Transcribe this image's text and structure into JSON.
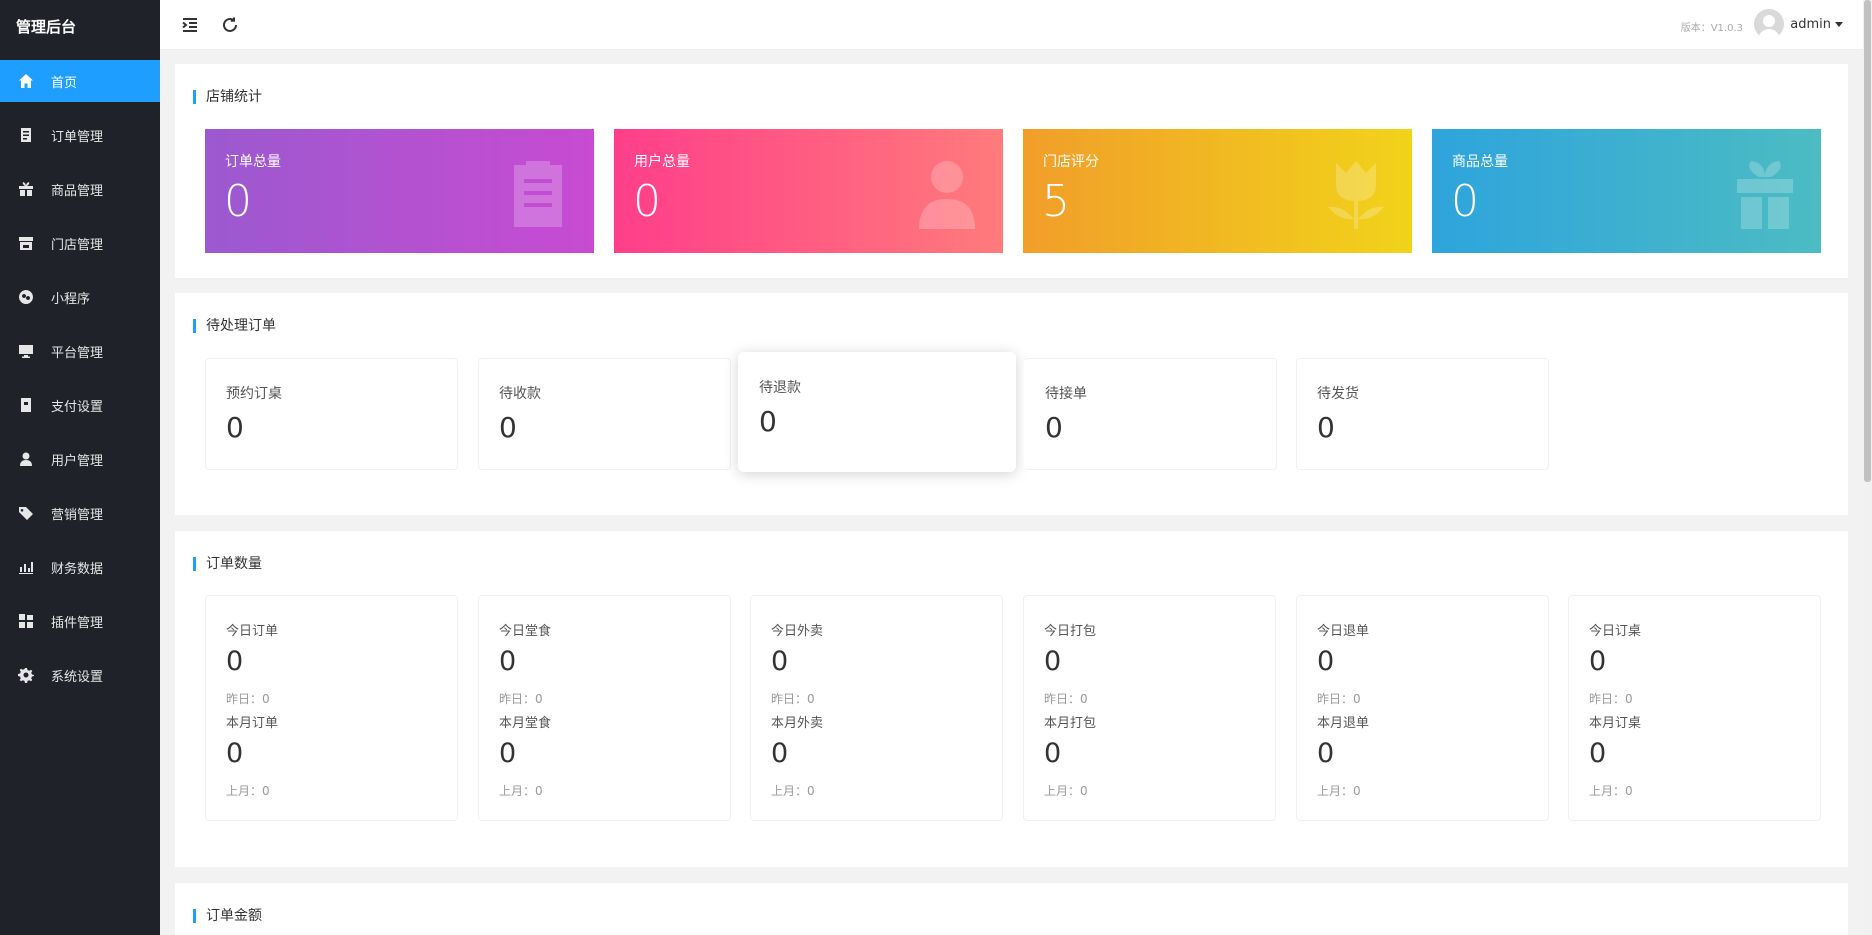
{
  "sidebar": {
    "brand": "管理后台",
    "items": [
      {
        "label": "首页",
        "icon": "home-icon"
      },
      {
        "label": "订单管理",
        "icon": "order-icon"
      },
      {
        "label": "商品管理",
        "icon": "gift-icon"
      },
      {
        "label": "门店管理",
        "icon": "store-icon"
      },
      {
        "label": "小程序",
        "icon": "miniprogram-icon"
      },
      {
        "label": "平台管理",
        "icon": "monitor-icon"
      },
      {
        "label": "支付设置",
        "icon": "wallet-icon"
      },
      {
        "label": "用户管理",
        "icon": "user-icon"
      },
      {
        "label": "营销管理",
        "icon": "tag-icon"
      },
      {
        "label": "财务数据",
        "icon": "chart-icon"
      },
      {
        "label": "插件管理",
        "icon": "plugin-icon"
      },
      {
        "label": "系统设置",
        "icon": "gear-icon"
      }
    ]
  },
  "header": {
    "version": "版本：V1.0.3",
    "username": "admin"
  },
  "store_stats": {
    "title": "店铺统计",
    "cards": [
      {
        "label": "订单总量",
        "value": "0",
        "icon": "clipboard-icon"
      },
      {
        "label": "用户总量",
        "value": "0",
        "icon": "person-icon"
      },
      {
        "label": "门店评分",
        "value": "5",
        "icon": "flower-icon"
      },
      {
        "label": "商品总量",
        "value": "0",
        "icon": "giftbox-icon"
      }
    ]
  },
  "pending_orders": {
    "title": "待处理订单",
    "cards": [
      {
        "label": "预约订桌",
        "value": "0"
      },
      {
        "label": "待收款",
        "value": "0"
      },
      {
        "label": "待退款",
        "value": "0"
      },
      {
        "label": "待接单",
        "value": "0"
      },
      {
        "label": "待发货",
        "value": "0"
      }
    ]
  },
  "order_count": {
    "title": "订单数量",
    "cards": [
      {
        "today_label": "今日订单",
        "today": "0",
        "yesterday": "昨日：0",
        "month_label": "本月订单",
        "month": "0",
        "last_month": "上月：0"
      },
      {
        "today_label": "今日堂食",
        "today": "0",
        "yesterday": "昨日：0",
        "month_label": "本月堂食",
        "month": "0",
        "last_month": "上月：0"
      },
      {
        "today_label": "今日外卖",
        "today": "0",
        "yesterday": "昨日：0",
        "month_label": "本月外卖",
        "month": "0",
        "last_month": "上月：0"
      },
      {
        "today_label": "今日打包",
        "today": "0",
        "yesterday": "昨日：0",
        "month_label": "本月打包",
        "month": "0",
        "last_month": "上月：0"
      },
      {
        "today_label": "今日退单",
        "today": "0",
        "yesterday": "昨日：0",
        "month_label": "本月退单",
        "month": "0",
        "last_month": "上月：0"
      },
      {
        "today_label": "今日订桌",
        "today": "0",
        "yesterday": "昨日：0",
        "month_label": "本月订桌",
        "month": "0",
        "last_month": "上月：0"
      }
    ]
  },
  "order_amount": {
    "title": "订单金额"
  }
}
